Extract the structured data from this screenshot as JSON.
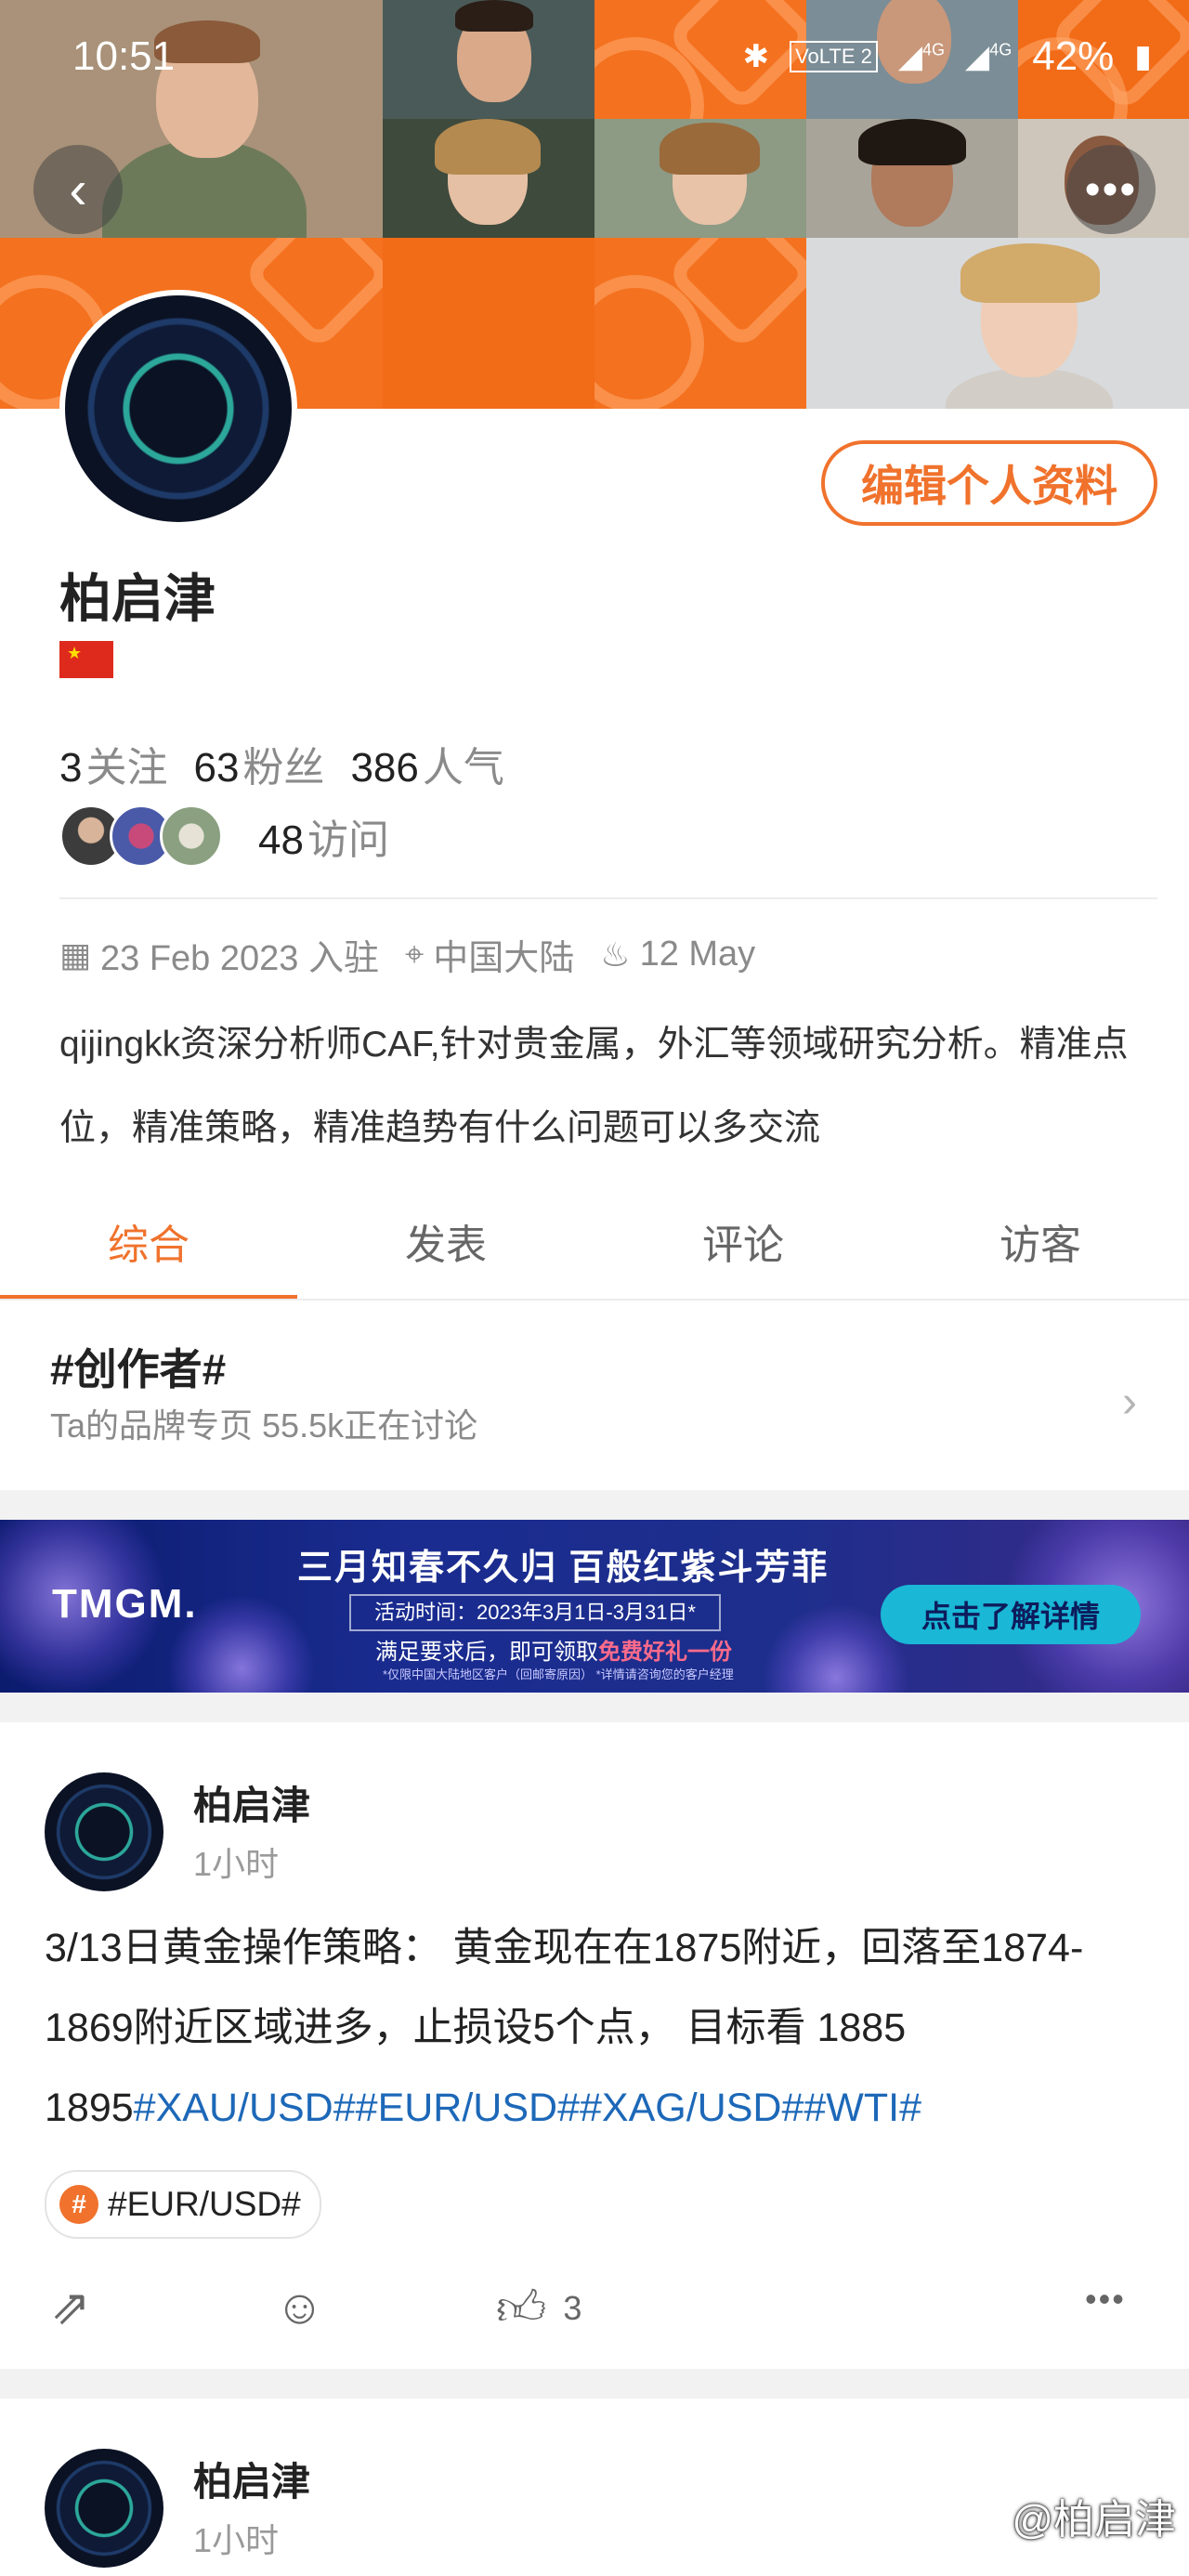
{
  "status_bar": {
    "time": "10:51",
    "battery": "42%",
    "network_1": "4G",
    "network_2": "4G",
    "volte": "VoLTE 2"
  },
  "header": {
    "back_icon": "chevron-left-icon",
    "more_icon": "more-horizontal-icon"
  },
  "profile": {
    "name": "柏启津",
    "edit_label": "编辑个人资料",
    "stats": [
      {
        "num": "3",
        "label": "关注"
      },
      {
        "num": "63",
        "label": "粉丝"
      },
      {
        "num": "386",
        "label": "人气"
      }
    ],
    "visits_num": "48",
    "visits_label": "访问",
    "joined": "23 Feb 2023 入驻",
    "location": "中国大陆",
    "birthday": "12 May",
    "bio": "qijingkk资深分析师CAF,针对贵金属，外汇等领域研究分析。精准点位，精准策略，精准趋势有什么问题可以多交流"
  },
  "tabs": [
    {
      "label": "综合",
      "active": true
    },
    {
      "label": "发表",
      "active": false
    },
    {
      "label": "评论",
      "active": false
    },
    {
      "label": "访客",
      "active": false
    }
  ],
  "topic": {
    "title": "#创作者#",
    "subtitle": "Ta的品牌专页  55.5k正在讨论"
  },
  "ad": {
    "logo": "TMGM.",
    "headline": "三月知春不久归 百般红紫斗芳菲",
    "date": "活动时间：2023年3月1日-3月31日*",
    "line_pre": "满足要求后，即可领取",
    "line_red": "免费好礼一份",
    "note": "*仅限中国大陆地区客户（回邮寄原因） *详情请咨询您的客户经理",
    "cta": "点击了解详情"
  },
  "posts": [
    {
      "author": "柏启津",
      "time": "1小时",
      "text": "3/13日黄金操作策略： 黄金现在在1875附近，回落至1874-1869附近区域进多，止损设5个点， 目标看 1885 1895",
      "hashtags": "#XAU/USD##EUR/USD##XAG/USD##WTI#",
      "tag": "#EUR/USD#",
      "likes": "3"
    },
    {
      "author": "柏启津",
      "time": "1小时"
    }
  ],
  "watermark": "@柏启津",
  "colors": {
    "accent": "#f0722c",
    "hashtag": "#1d68b8",
    "muted": "#8a8a8a"
  }
}
